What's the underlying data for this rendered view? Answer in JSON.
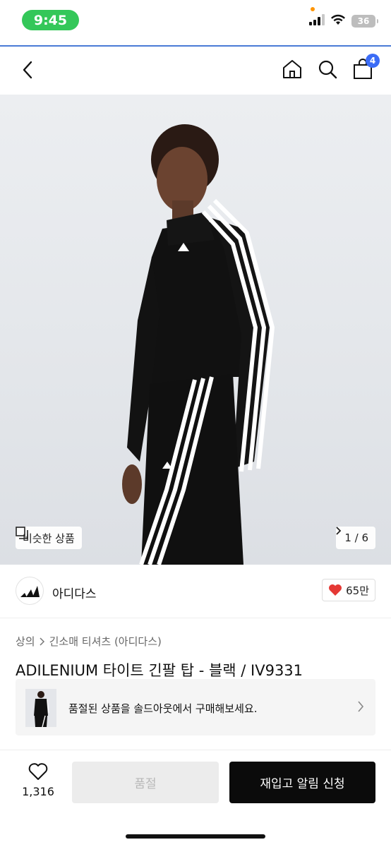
{
  "status_bar": {
    "time": "9:45",
    "battery": "36",
    "icons": [
      "cellular-signal-icon",
      "wifi-icon",
      "battery-icon"
    ]
  },
  "nav": {
    "icons": [
      "back-chevron-icon",
      "home-icon",
      "search-icon",
      "shopping-bag-icon"
    ],
    "cart_count": "4"
  },
  "gallery": {
    "similar_label": "비슷한 상품",
    "page_indicator": "1 / 6"
  },
  "brand": {
    "name": "아디다스",
    "like_count": "65만"
  },
  "breadcrumb": {
    "category": "상의",
    "subcategory": "긴소매 티셔츠 (아디다스)"
  },
  "product": {
    "title": "ADILENIUM 타이트 긴팔 탑 - 블랙 / IV9331"
  },
  "soldout_banner": {
    "text": "품절된 상품을 솔드아웃에서 구매해보세요."
  },
  "bottom_bar": {
    "wish_count": "1,316",
    "soldout_label": "품절",
    "restock_label": "재입고 알림 신청"
  },
  "colors": {
    "accent_badge": "#3b6cf6",
    "time_pill": "#34c759",
    "like_heart": "#e53935",
    "primary_button": "#0b0b0b"
  }
}
